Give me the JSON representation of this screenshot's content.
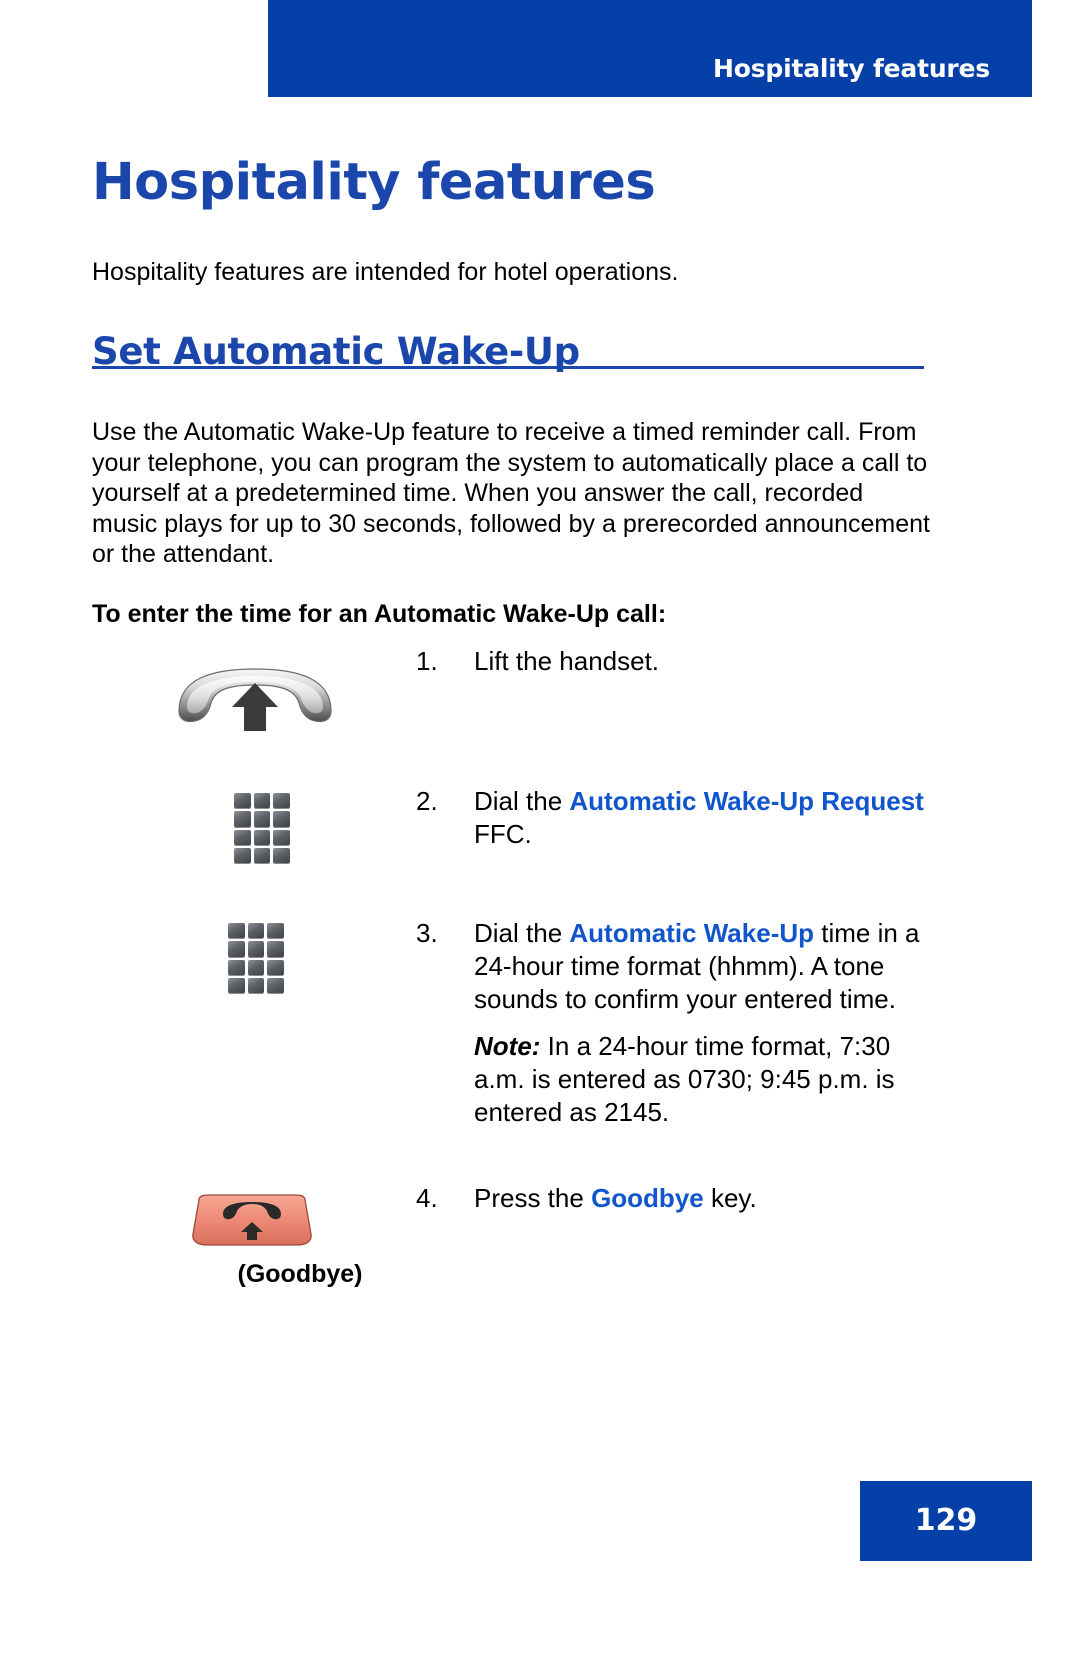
{
  "header": {
    "running_title": "Hospitality features",
    "bar_color": "#0540a8"
  },
  "chapter": {
    "title": "Hospitality features",
    "title_color": "#1b46ab",
    "intro": "Hospitality features are intended for hotel operations."
  },
  "section": {
    "heading": "Set Automatic Wake-Up",
    "heading_color": "#1b46ab",
    "paragraph": "Use the Automatic Wake-Up feature to receive a timed reminder call. From your telephone, you can program the system to automatically place a call to yourself at a predetermined time. When you answer the call, recorded music plays for up to 30 seconds, followed by a prerecorded announcement or the attendant.",
    "lead_in": "To enter the time for an Automatic Wake-Up call:"
  },
  "steps": [
    {
      "number": "1.",
      "icon": "handset-icon",
      "text_parts": [
        {
          "text": "Lift the handset.",
          "style": "plain"
        }
      ]
    },
    {
      "number": "2.",
      "icon": "keypad-icon",
      "text_parts": [
        {
          "text": "Dial the ",
          "style": "plain"
        },
        {
          "text": "Automatic Wake-Up Request",
          "style": "keyword"
        },
        {
          "text": " FFC.",
          "style": "plain"
        }
      ]
    },
    {
      "number": "3.",
      "icon": "keypad-icon",
      "text_parts": [
        {
          "text": "Dial the ",
          "style": "plain"
        },
        {
          "text": "Automatic Wake-Up",
          "style": "keyword"
        },
        {
          "text": " time in a 24-hour time format (hhmm). A tone sounds to confirm your entered time.",
          "style": "plain"
        }
      ],
      "note": {
        "label": "Note:",
        "text": " In a 24-hour time format, 7:30 a.m. is entered as 0730; 9:45 p.m. is entered as 2145."
      }
    },
    {
      "number": "4.",
      "icon": "goodbye-key-icon",
      "icon_caption": "(Goodbye)",
      "text_parts": [
        {
          "text": "Press the ",
          "style": "plain"
        },
        {
          "text": "Goodbye",
          "style": "keyword"
        },
        {
          "text": " key.",
          "style": "plain"
        }
      ]
    }
  ],
  "footer": {
    "page_number": "129",
    "box_color": "#0540a8"
  },
  "colors": {
    "brand_blue": "#0540a8",
    "heading_blue": "#1b46ab",
    "keyword_blue": "#1155cc",
    "goodbye_key_salmon": "#f2907e"
  }
}
